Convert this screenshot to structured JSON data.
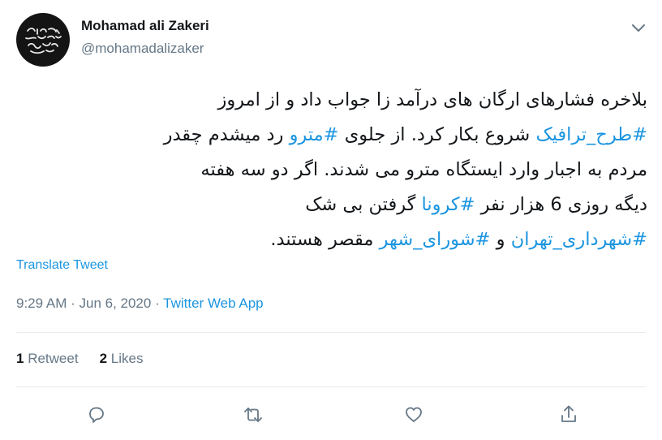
{
  "author": {
    "name": "Mohamad ali Zakeri",
    "handle": "@mohamadalizaker"
  },
  "tweet": {
    "lines": [
      [
        {
          "text": "بلاخره فشارهای ارگان های درآمد زا جواب داد و از امروز",
          "tag": false
        }
      ],
      [
        {
          "text": "#طرح_ترافیک",
          "tag": true
        },
        {
          "text": " شروع بکار کرد. از جلوی ",
          "tag": false
        },
        {
          "text": "#مترو",
          "tag": true
        },
        {
          "text": " رد میشدم چقدر",
          "tag": false
        }
      ],
      [
        {
          "text": "مردم به اجبار وارد ایستگاه مترو می شدند. اگر دو سه هفته",
          "tag": false
        }
      ],
      [
        {
          "text": "دیگه روزی 6 هزار نفر ",
          "tag": false
        },
        {
          "text": "#کرونا",
          "tag": true
        },
        {
          "text": " گرفتن بی شک",
          "tag": false
        }
      ],
      [
        {
          "text": "#شهرداری_تهران",
          "tag": true
        },
        {
          "text": " و ",
          "tag": false
        },
        {
          "text": "#شورای_شهر",
          "tag": true
        },
        {
          "text": " مقصر هستند.",
          "tag": false
        }
      ]
    ]
  },
  "translate_label": "Translate Tweet",
  "meta": {
    "time": "9:29 AM",
    "separator": " · ",
    "date": "Jun 6, 2020",
    "source": "Twitter Web App"
  },
  "stats": {
    "retweets_count": "1",
    "retweets_label": " Retweet",
    "likes_count": "2",
    "likes_label": " Likes"
  },
  "icons": {
    "avatar": "hand-lettered-logo-avatar",
    "more": "chevron-down-icon",
    "reply": "reply-icon",
    "retweet": "retweet-icon",
    "like": "heart-icon",
    "share": "share-icon"
  },
  "colors": {
    "link": "#1b95e0",
    "text": "#14171a",
    "muted": "#657786",
    "divider": "#e6ecf0",
    "avatar_bg": "#141414"
  }
}
